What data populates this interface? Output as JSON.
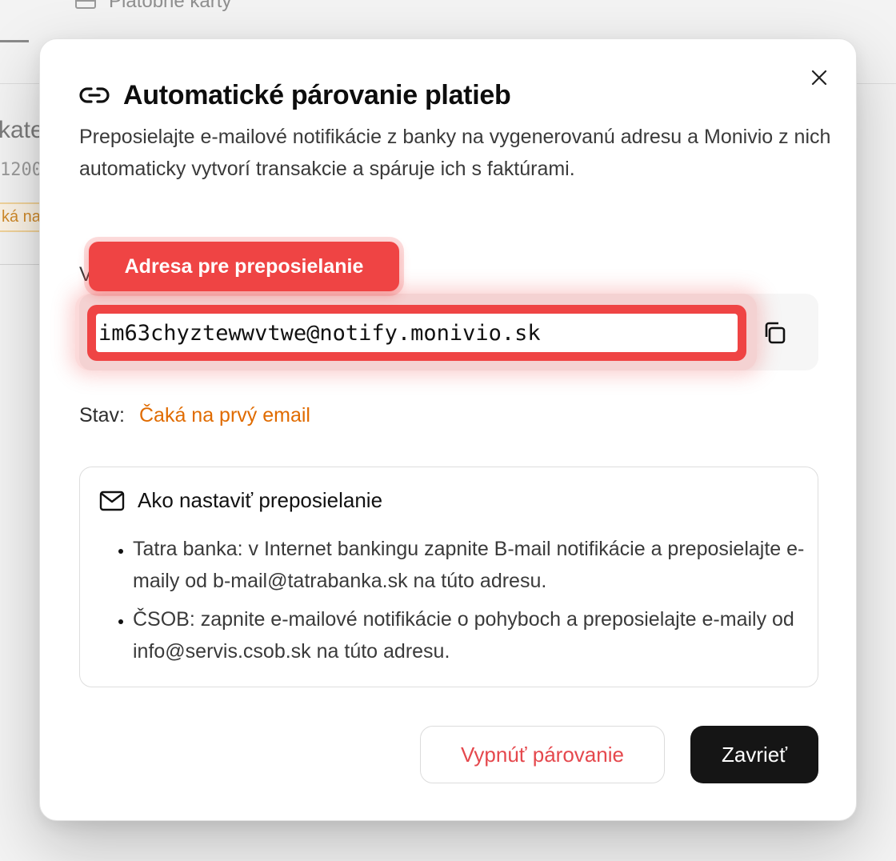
{
  "background": {
    "tab_label": "Platobné karty",
    "category_fragment": "kate",
    "number_fragment": "1200",
    "badge_fragment": "ká na"
  },
  "modal": {
    "title": "Automatické párovanie platieb",
    "title_icon": "link-icon",
    "description": "Preposielajte e-mailové notifikácie z banky na vygenerovanú adresu a Monivio z nich automaticky vytvorí transakcie a spáruje ich s faktúrami.",
    "hidden_label_fragment": "V",
    "tooltip": "Adresa pre preposielanie",
    "forwarding_address": "im63chyztewwvtwe@notify.monivio.sk",
    "copy_icon": "copy-icon",
    "close_icon": "close-icon",
    "status": {
      "label": "Stav:",
      "value": "Čaká na prvý email",
      "color": "#e06b00"
    },
    "howto": {
      "icon": "mail-icon",
      "title": "Ako nastaviť preposielanie",
      "items": [
        "Tatra banka: v Internet bankingu zapnite B-mail notifikácie a preposielajte e-maily od b-mail@tatrabanka.sk na túto adresu.",
        "ČSOB: zapnite e-mailové notifikácie o pohyboch a preposielajte e-maily od info@servis.csob.sk na túto adresu."
      ]
    },
    "buttons": {
      "disable": "Vypnúť párovanie",
      "close": "Zavrieť"
    },
    "colors": {
      "highlight": "#ef4444",
      "danger_text": "#e5484d",
      "primary_button": "#151515"
    }
  }
}
